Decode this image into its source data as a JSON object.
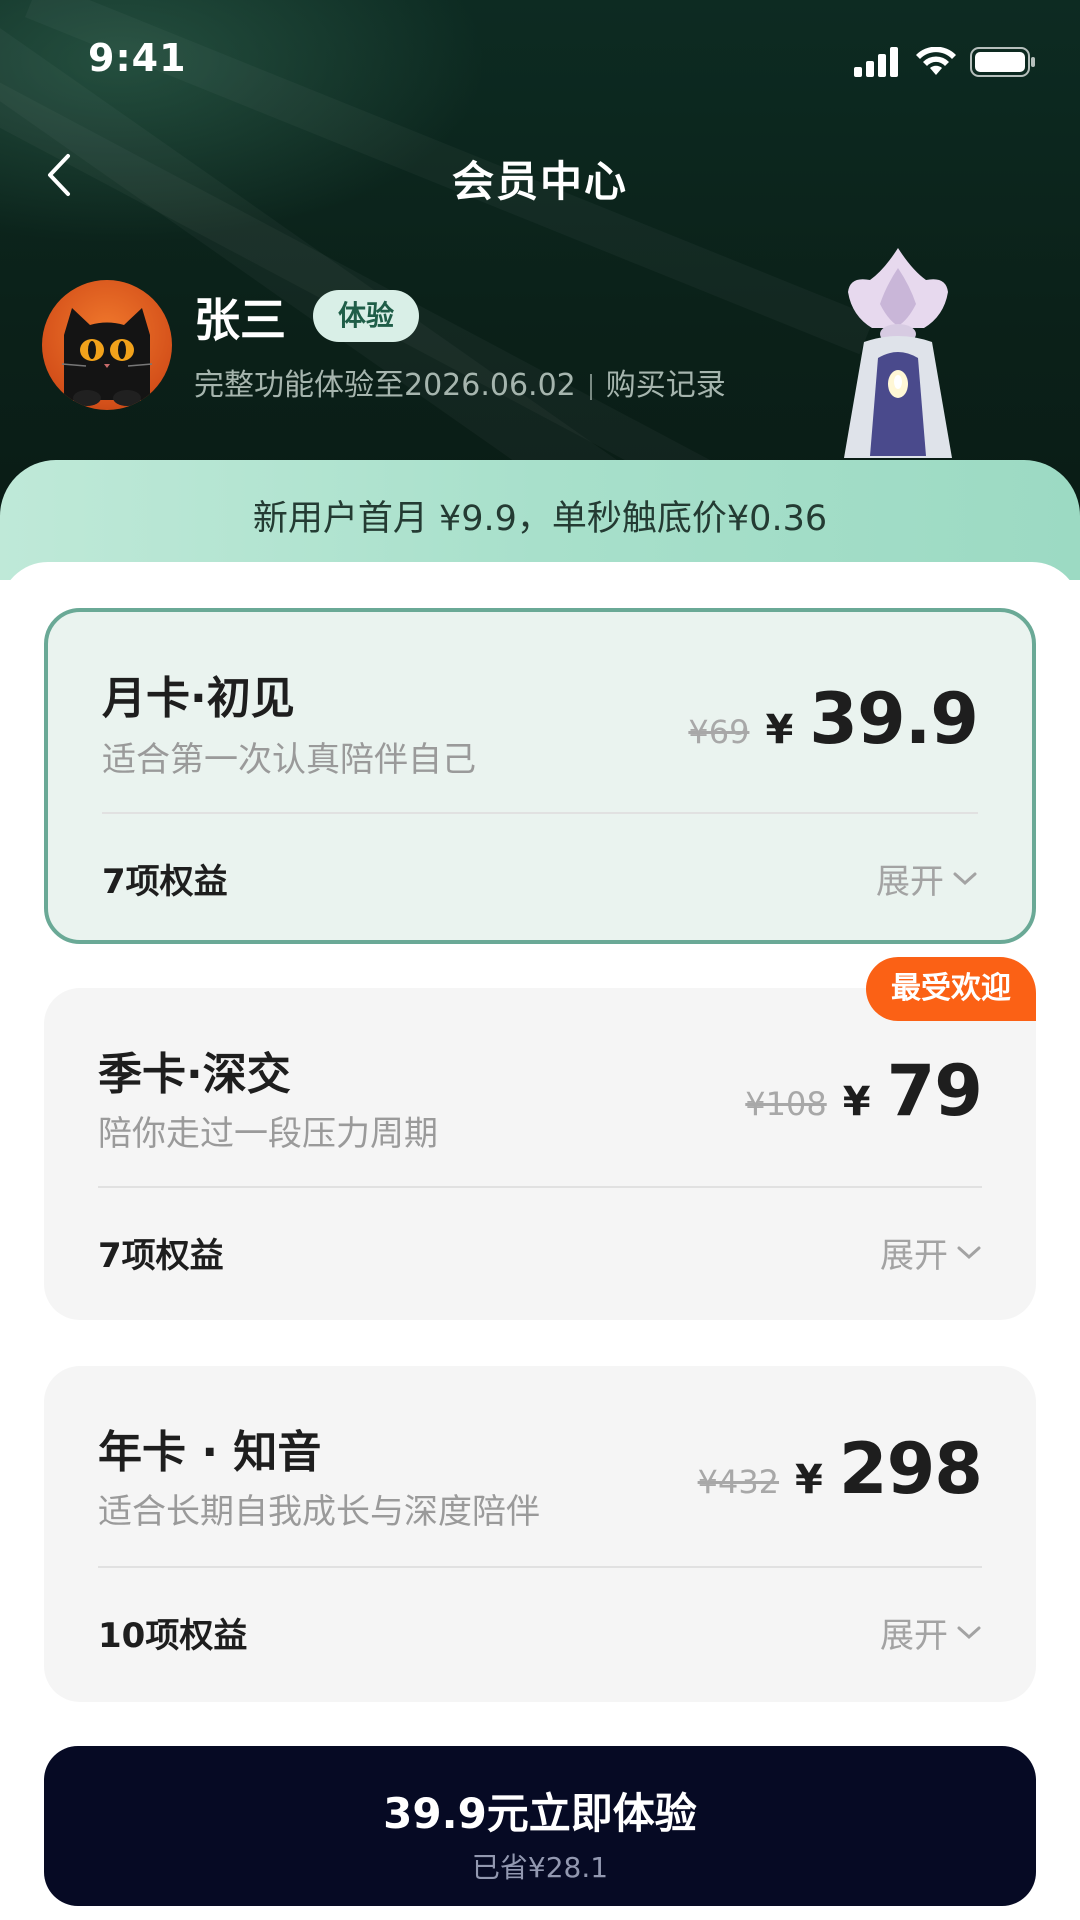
{
  "status_bar": {
    "time": "9:41",
    "icons": [
      "signal-icon",
      "wifi-icon",
      "battery-icon"
    ]
  },
  "nav": {
    "title": "会员中心",
    "back_icon": "chevron-left-icon"
  },
  "user": {
    "name": "张三",
    "badge": "体验",
    "subtitle": "完整功能体验至2026.06.02",
    "purchase_link": "购买记录"
  },
  "promo": {
    "text": "新用户首月 ¥9.9，单秒触底价¥0.36"
  },
  "plans": [
    {
      "name": "月卡·初见",
      "desc": "适合第一次认真陪伴自己",
      "original_price": "¥69",
      "currency": "¥",
      "price": "39.9",
      "benefits": "7项权益",
      "expand": "展开",
      "selected": true
    },
    {
      "name": "季卡·深交",
      "desc": "陪你走过一段压力周期",
      "original_price": "¥108",
      "currency": "¥",
      "price": "79",
      "benefits": "7项权益",
      "expand": "展开",
      "tag": "最受欢迎",
      "selected": false
    },
    {
      "name": "年卡 · 知音",
      "desc": "适合长期自我成长与深度陪伴",
      "original_price": "¥432",
      "currency": "¥",
      "price": "298",
      "benefits": "10项权益",
      "expand": "展开",
      "selected": false
    }
  ],
  "cta": {
    "label": "39.9元立即体验",
    "sub": "已省¥28.1"
  },
  "colors": {
    "accent": "#6aa996",
    "hot": "#fb6115",
    "cta_bg": "#060a24",
    "hero_bg": "#0d2b22"
  }
}
